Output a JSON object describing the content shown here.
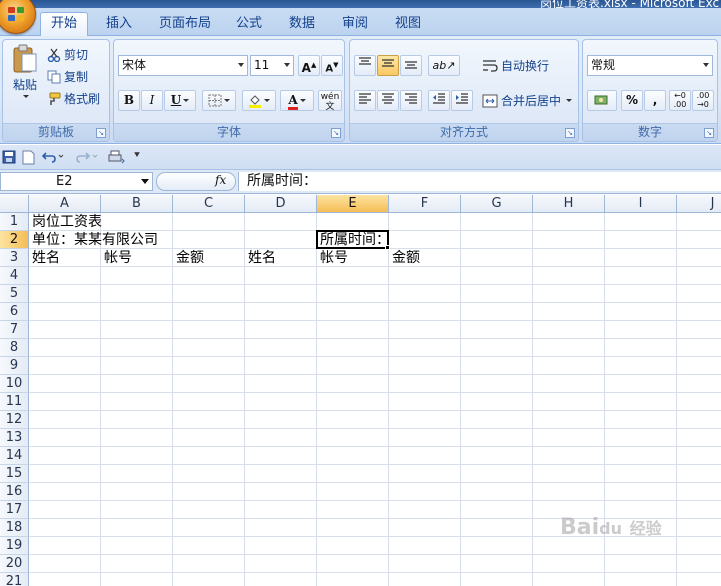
{
  "window": {
    "title": "岗位工资表.xlsx - Microsoft Exc"
  },
  "tabs": [
    {
      "label": "开始",
      "active": true
    },
    {
      "label": "插入"
    },
    {
      "label": "页面布局"
    },
    {
      "label": "公式"
    },
    {
      "label": "数据"
    },
    {
      "label": "审阅"
    },
    {
      "label": "视图"
    }
  ],
  "ribbon": {
    "clipboard": {
      "label": "剪贴板",
      "paste": "粘贴",
      "cut": "剪切",
      "copy": "复制",
      "format_painter": "格式刷"
    },
    "font": {
      "label": "字体",
      "name": "宋体",
      "size": "11",
      "bold": "B",
      "italic": "I",
      "underline": "U",
      "font_color_letter": "A",
      "font_color": "#e0201c",
      "highlight_color": "#f6f000",
      "phonetic": "wén"
    },
    "alignment": {
      "label": "对齐方式",
      "wrap_text": "自动换行",
      "merge_center": "合并后居中"
    },
    "number": {
      "label": "数字",
      "format": "常规",
      "percent": "%",
      "comma": ","
    }
  },
  "formula_bar": {
    "name_box": "E2",
    "fx": "fx",
    "content": "所属时间："
  },
  "sheet": {
    "columns": [
      "A",
      "B",
      "C",
      "D",
      "E",
      "F",
      "G",
      "H",
      "I",
      "J"
    ],
    "selected_column": "E",
    "rows": [
      "1",
      "2",
      "3",
      "4",
      "5",
      "6",
      "7",
      "8",
      "9",
      "10",
      "11",
      "12",
      "13",
      "14",
      "15",
      "16",
      "17",
      "18",
      "19",
      "20",
      "21"
    ],
    "selected_row": "2",
    "cells": {
      "A1": "岗位工资表",
      "A2": "单位：某某有限公司",
      "E2": "所属时间：",
      "A3": "姓名",
      "B3": "帐号",
      "C3": "金额",
      "D3": "姓名",
      "E3": "帐号",
      "F3": "金额"
    },
    "active_cell": "E2"
  },
  "watermark": {
    "brand": "Bai",
    "suffix": "du",
    "label": "经验"
  }
}
